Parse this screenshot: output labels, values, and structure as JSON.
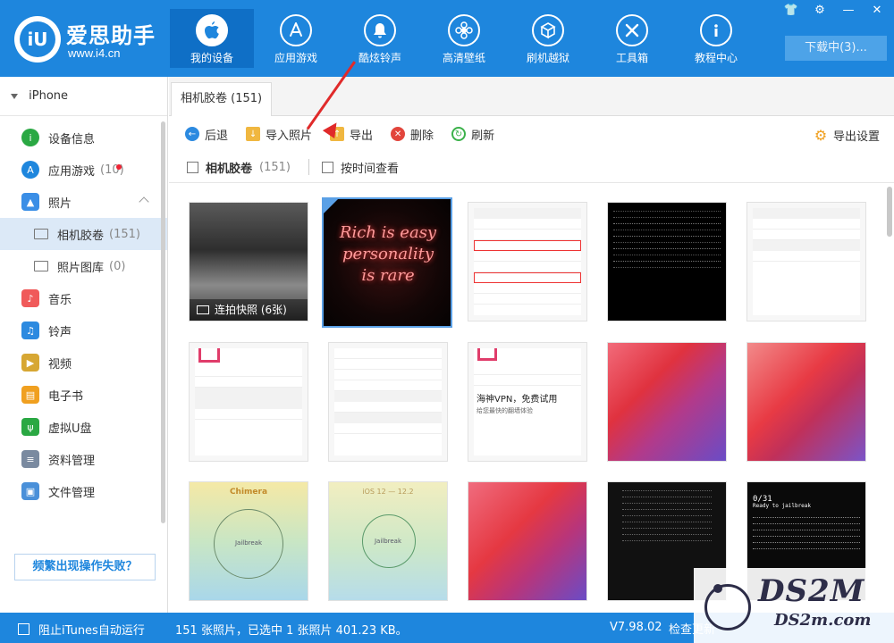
{
  "app": {
    "logo_mark": "iU",
    "name": "爱思助手",
    "url": "www.i4.cn"
  },
  "nav": [
    {
      "label": "我的设备",
      "icon": "apple-icon",
      "active": true
    },
    {
      "label": "应用游戏",
      "icon": "app-store-icon"
    },
    {
      "label": "酷炫铃声",
      "icon": "bell-icon"
    },
    {
      "label": "高清壁纸",
      "icon": "flower-icon"
    },
    {
      "label": "刷机越狱",
      "icon": "box-icon"
    },
    {
      "label": "工具箱",
      "icon": "tools-icon"
    },
    {
      "label": "教程中心",
      "icon": "info-icon"
    }
  ],
  "window_controls": [
    "👕",
    "⚙",
    "—",
    "✕"
  ],
  "download_label": "下载中(3)...",
  "device": {
    "name": "iPhone"
  },
  "sidebar": {
    "items": [
      {
        "label": "设备信息",
        "icon": "info-circle-icon",
        "color": "#2aa843"
      },
      {
        "label": "应用游戏",
        "icon": "app-store-icon",
        "color": "#1e86dd",
        "count": "(10)"
      },
      {
        "label": "照片",
        "icon": "photo-icon",
        "color": "#3a8ee6"
      },
      {
        "label": "相机胶卷",
        "count": "(151)",
        "sub": true,
        "active": true
      },
      {
        "label": "照片图库",
        "count": "(0)",
        "sub": true
      },
      {
        "label": "音乐",
        "icon": "music-icon",
        "color": "#f05a5a"
      },
      {
        "label": "铃声",
        "icon": "bell-icon",
        "color": "#2c8ae0"
      },
      {
        "label": "视频",
        "icon": "film-icon",
        "color": "#d7a733"
      },
      {
        "label": "电子书",
        "icon": "book-icon",
        "color": "#f0a020"
      },
      {
        "label": "虚拟U盘",
        "icon": "usb-icon",
        "color": "#2aa843"
      },
      {
        "label": "资料管理",
        "icon": "document-icon",
        "color": "#7a8aa0"
      },
      {
        "label": "文件管理",
        "icon": "folder-icon",
        "color": "#4a90d9"
      }
    ],
    "help_label": "频繁出现操作失败？"
  },
  "tab": {
    "label": "相机胶卷 (151)"
  },
  "toolbar": {
    "back": "后退",
    "import": "导入照片",
    "export": "导出",
    "delete": "删除",
    "refresh": "刷新",
    "export_settings": "导出设置"
  },
  "filter": {
    "label": "相机胶卷",
    "count": "(151)",
    "by_time": "按时间查看"
  },
  "thumbnails": {
    "burst_caption": "连拍快照 (6张)",
    "neon_text": "Rich is easy personality is rare",
    "row2_ad": "海神VPN，免费试用",
    "row2_ad_sub": "给您最快的翻墙体验",
    "chimera": "Chimera",
    "jailbreak": "Jailbreak",
    "ios_range": "iOS 12 — 12.2",
    "jb_count": "0/31",
    "jb_ready": "Ready to jailbreak"
  },
  "statusbar": {
    "itunes_label": "阻止iTunes自动运行",
    "status": "151 张照片，已选中 1 张照片 401.23 KB。",
    "version": "V7.98.02",
    "update": "检查更新"
  },
  "watermark": {
    "big": "DS2M",
    "small": "DS2m.com"
  }
}
